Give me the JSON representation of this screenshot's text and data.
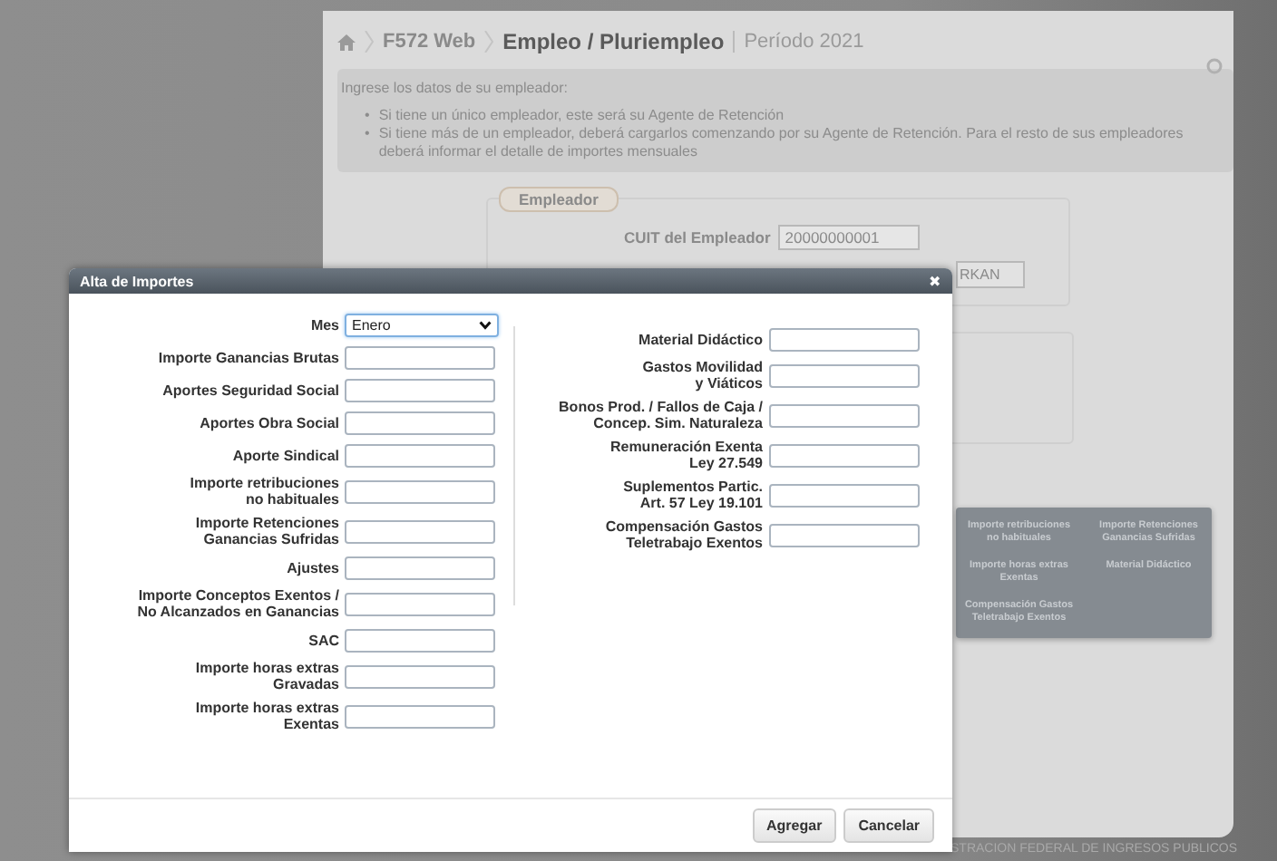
{
  "breadcrumb": [
    {
      "label": "F572 Web",
      "current": false
    },
    {
      "label": "Empleo / Pluriempleo",
      "current": true
    }
  ],
  "period": "Período 2021",
  "info": {
    "intro": "Ingrese los datos de su empleador:",
    "marker": "•",
    "bullets": [
      "Si tiene un único empleador, este será su Agente de Retención",
      "Si tiene más de un empleador, deberá cargarlos comenzando por su Agente de Retención. Para el resto de sus empleadores deberá informar el detalle de importes mensuales"
    ]
  },
  "employer_panel": {
    "legend": "Empleador",
    "cuit_label": "CUIT del Empleador",
    "cuit_value": "20000000001",
    "button_label": "RKAN"
  },
  "summary_table": {
    "cells": [
      "Importe retribuciones\nno habituales",
      "Importe Retenciones\nGanancias Sufridas",
      "Importe horas extras\nExentas",
      "Material Didáctico",
      "Compensación Gastos\nTeletrabajo Exentos"
    ]
  },
  "footer": "STRACION FEDERAL DE INGRESOS PUBLICOS",
  "dialog": {
    "title": "Alta de Importes",
    "close": "✖",
    "month": {
      "label": "Mes",
      "value": "Enero"
    },
    "left_fields": [
      {
        "label": "Importe Ganancias Brutas"
      },
      {
        "label": "Aportes Seguridad Social"
      },
      {
        "label": "Aportes Obra Social"
      },
      {
        "label": "Aporte Sindical"
      },
      {
        "label": "Importe retribuciones\nno habituales"
      },
      {
        "label": "Importe Retenciones\nGanancias Sufridas"
      },
      {
        "label": "Ajustes"
      },
      {
        "label": "Importe Conceptos Exentos /\nNo Alcanzados en Ganancias"
      },
      {
        "label": "SAC"
      },
      {
        "label": "Importe horas extras\nGravadas"
      },
      {
        "label": "Importe horas extras\nExentas"
      }
    ],
    "right_fields": [
      {
        "label": "Material Didáctico"
      },
      {
        "label": "Gastos Movilidad\ny Viáticos"
      },
      {
        "label": "Bonos Prod. / Fallos de Caja /\nConcep. Sim. Naturaleza"
      },
      {
        "label": "Remuneración Exenta\nLey 27.549"
      },
      {
        "label": "Suplementos Partic.\nArt. 57 Ley 19.101"
      },
      {
        "label": "Compensación Gastos\nTeletrabajo Exentos"
      }
    ],
    "buttons": [
      "Agregar",
      "Cancelar"
    ]
  }
}
